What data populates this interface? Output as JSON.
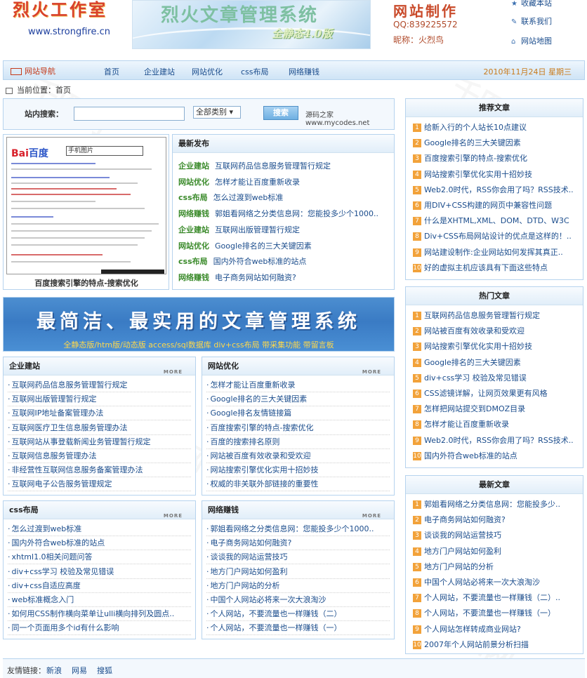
{
  "header": {
    "logo_title": "烈火工作室",
    "logo_url": "www.strongfire.cn",
    "banner_title": "烈火文章管理系统",
    "banner_sub": "全静态4.0版",
    "contact_title": "网站制作",
    "contact_qq": "QQ:839225572",
    "contact_nick": "昵称：火烈鸟",
    "links": [
      {
        "label": "收藏本站",
        "icon": "star-icon"
      },
      {
        "label": "联系我们",
        "icon": "pencil-icon"
      },
      {
        "label": "网站地图",
        "icon": "home-icon"
      }
    ]
  },
  "nav": {
    "label": "网站导航",
    "items": [
      "首页",
      "企业建站",
      "网站优化",
      "css布局",
      "网络赚钱"
    ],
    "date": "2010年11月24日 星期三"
  },
  "breadcrumb": "当前位置：首页",
  "search": {
    "label": "站内搜索：",
    "input_value": "",
    "select_value": "全部类别",
    "button_label": "搜索",
    "note": "源码之家www.mycodes.net"
  },
  "image_news": {
    "caption": "百度搜索引擎的特点-搜索优化",
    "baidu_logo": "Bai百度",
    "search_text": "手机图片"
  },
  "latest_release": {
    "title": "最新发布",
    "items": [
      {
        "cat": "企业建站",
        "title": "互联网药品信息服务管理暂行规定"
      },
      {
        "cat": "网站优化",
        "title": "怎样才能让百度重新收录"
      },
      {
        "cat": "css布局",
        "title": "怎么过渡到web标准"
      },
      {
        "cat": "网络赚钱",
        "title": "郭姐看网络之分类信息网：您能投多少个1000.."
      },
      {
        "cat": "企业建站",
        "title": "互联网出版管理暂行规定"
      },
      {
        "cat": "网站优化",
        "title": "Google排名的三大关键因素"
      },
      {
        "cat": "css布局",
        "title": "国内外符合web标准的站点"
      },
      {
        "cat": "网络赚钱",
        "title": "电子商务网站如何融资?"
      }
    ]
  },
  "banner2": {
    "title": "最简洁、最实用的文章管理系统",
    "sub": "全静态版/htm版/动态版   access/sql数据库  div+css布局  带采集功能  带留言板"
  },
  "more_label": "MORE",
  "categories": [
    {
      "title": "企业建站",
      "items": [
        "互联网药品信息服务管理暂行规定",
        "互联网出版管理暂行规定",
        "互联网IP地址备案管理办法",
        "互联网医疗卫生信息服务管理办法",
        "互联网站从事登载新闻业务管理暂行规定",
        "互联网信息服务管理办法",
        "非经营性互联网信息服务备案管理办法",
        "互联网电子公告服务管理规定"
      ]
    },
    {
      "title": "网站优化",
      "items": [
        "怎样才能让百度重新收录",
        "Google排名的三大关键因素",
        "Google排名友情链接篇",
        "百度搜索引擎的特点-搜索优化",
        "百度的搜索排名原则",
        "网站被百度有效收录和受欢迎",
        "网站搜索引擎优化实用十招妙技",
        "权威的非关联外部链接的重要性"
      ]
    },
    {
      "title": "css布局",
      "items": [
        "怎么过渡到web标准",
        "国内外符合web标准的站点",
        "xhtml1.0相关问题问答",
        "div+css学习   校验及常见错误",
        "div+css自适应高度",
        "web标准概念入门",
        "如何用CSS制作横向菜单让ulli横向排列及圆点..",
        "同一个页面用多个id有什么影响"
      ]
    },
    {
      "title": "网络赚钱",
      "items": [
        "郭姐看网络之分类信息网：您能投多少个1000..",
        "电子商务网站如何融资?",
        "谈谈我的网站运营技巧",
        "地方门户网站如何盈利",
        "地方门户网站的分析",
        "中国个人网站必将来一次大浪淘沙",
        "个人网站，不要流量也一样赚钱（二）",
        "个人网站，不要流量也一样赚钱（一）"
      ]
    }
  ],
  "sidebar": [
    {
      "title": "推荐文章",
      "items": [
        "给新入行的个人站长10点建议",
        "Google排名的三大关键因素",
        "百度搜索引擎的特点-搜索优化",
        "网站搜索引擎优化实用十招妙技",
        "Web2.0时代，RSS你会用了吗？RSS技术..",
        "用DIV+CSS构建的网页中兼容性问题",
        "什么是XHTML,XML、DOM、DTD、W3C",
        "Div+CSS布局网站设计的优点是这样的！..",
        "网站建设制作:企业网站如何发挥其真正..",
        "好的虚拟主机应该具有下面这些特点"
      ]
    },
    {
      "title": "热门文章",
      "items": [
        "互联网药品信息服务管理暂行规定",
        "网站被百度有效收录和受欢迎",
        "网站搜索引擎优化实用十招妙技",
        "Google排名的三大关键因素",
        "div+css学习   校验及常见错误",
        "CSS滤镜详解，让网页效果更有风格",
        "怎样把网站提交到DMOZ目录",
        "怎样才能让百度重新收录",
        "Web2.0时代，RSS你会用了吗？RSS技术..",
        "国内外符合web标准的站点"
      ]
    },
    {
      "title": "最新文章",
      "items": [
        "郭姐看网络之分类信息网：您能投多少..",
        "电子商务网站如何融资?",
        "谈谈我的网站运营技巧",
        "地方门户网站如何盈利",
        "地方门户网站的分析",
        "中国个人网站必将来一次大浪淘沙",
        "个人网站，不要流量也一样赚钱（二）..",
        "个人网站，不要流量也一样赚钱（一）",
        "个人网站怎样转成商业网站?",
        "2007年个人网站前景分析扫描"
      ]
    }
  ],
  "footer": {
    "label": "友情链接：",
    "links": [
      "新浪",
      "网易",
      "搜狐"
    ]
  },
  "colors": {
    "border": "#b6d3ee",
    "link": "#1a4c8c",
    "accent": "#f2a23a",
    "category": "#3a8a2a"
  }
}
